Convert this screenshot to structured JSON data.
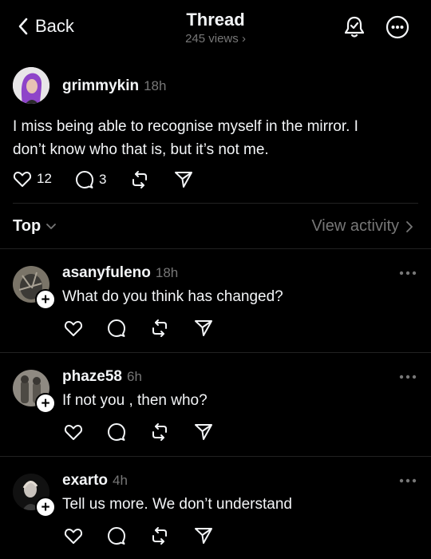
{
  "header": {
    "back_label": "Back",
    "title": "Thread",
    "views": "245 views"
  },
  "post": {
    "username": "grimmykin",
    "time": "18h",
    "text_line1": "I miss being able to recognise myself in the mirror. I",
    "text_line2": "don’t know who that is, but it’s not me.",
    "likes": "12",
    "replies": "3"
  },
  "sort": {
    "label": "Top",
    "activity_label": "View activity"
  },
  "replies": [
    {
      "username": "asanyfuleno",
      "time": "18h",
      "text": "What do you think has changed?"
    },
    {
      "username": "phaze58",
      "time": "6h",
      "text": "If not you , then who?"
    },
    {
      "username": "exarto",
      "time": "4h",
      "text": "Tell us more. We don’t understand"
    }
  ],
  "colors": {
    "background": "#000000",
    "text": "#f3f5f7",
    "muted": "#777777",
    "avatar_purple": "#8e44c9"
  },
  "icons": {
    "back": "chevron-left-icon",
    "notify": "bell-icon",
    "more": "more-circle-icon",
    "like": "heart-icon",
    "reply": "comment-icon",
    "repost": "repost-icon",
    "share": "send-icon"
  }
}
